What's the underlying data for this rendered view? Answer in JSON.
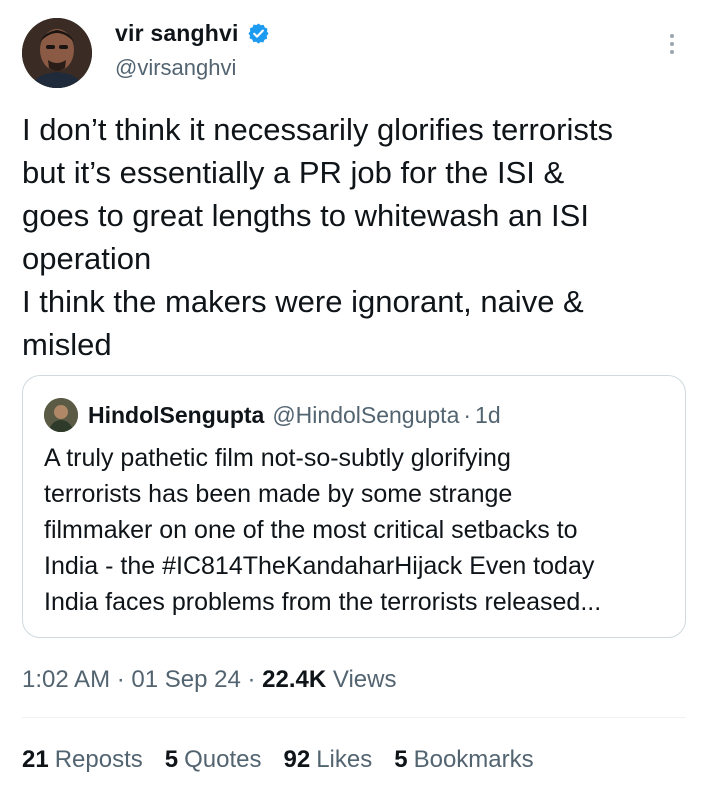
{
  "author": {
    "display_name": "vir sanghvi",
    "handle": "@virsanghvi",
    "verified": true,
    "verified_color": "#1d9bf0"
  },
  "tweet": {
    "text": "I don’t think it necessarily glorifies terrorists\nbut it’s essentially a PR job for the ISI &\ngoes to great lengths to whitewash an ISI\noperation\nI think the makers were ignorant, naive &\nmisled"
  },
  "quoted": {
    "display_name": "HindolSengupta",
    "handle": "@HindolSengupta",
    "separator": "·",
    "time": "1d",
    "text": "A truly pathetic film not-so-subtly glorifying\nterrorists has been made by some strange\nfilmmaker on one of the most critical setbacks to\nIndia - the #IC814TheKandaharHijack Even today\nIndia faces problems from the terrorists released..."
  },
  "meta": {
    "time": "1:02 AM",
    "sep1": " · ",
    "date": "01 Sep 24",
    "sep2": " · ",
    "views_count": "22.4K",
    "views_label": "Views"
  },
  "stats": [
    {
      "count": "21",
      "label": "Reposts"
    },
    {
      "count": "5",
      "label": "Quotes"
    },
    {
      "count": "92",
      "label": "Likes"
    },
    {
      "count": "5",
      "label": "Bookmarks"
    }
  ],
  "icons": {
    "verified": "verified-badge-icon",
    "more": "more-vertical-icon"
  }
}
